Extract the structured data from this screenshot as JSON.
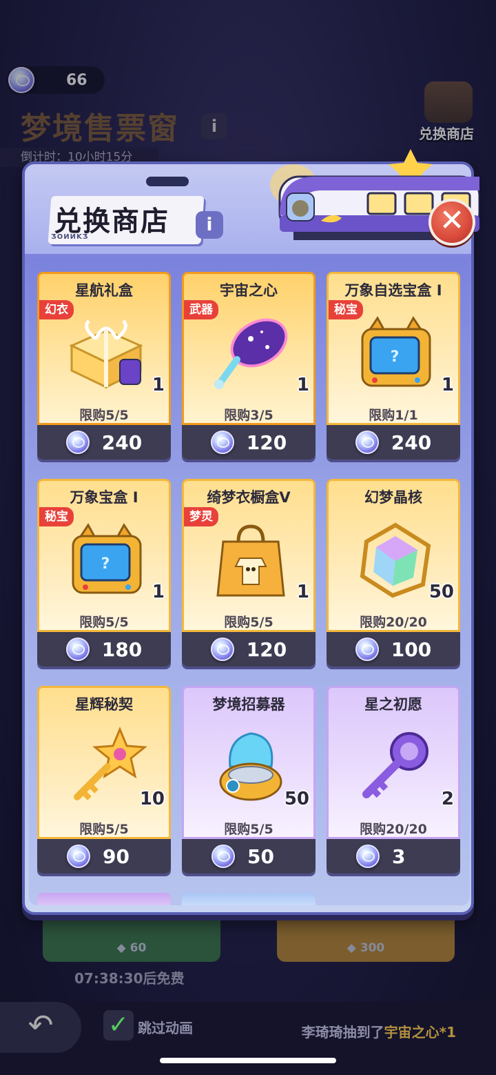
{
  "hud": {
    "currency_value": "66",
    "bg_title": "梦境售票窗",
    "countdown": "倒计时：10小时15分",
    "shop_shortcut_label": "兑换商店",
    "free_timer": "07:38:30后免费",
    "draw_once_cost": "60",
    "draw_five_cost": "300",
    "skip_animation_label": "跳过动画",
    "ticker_prefix": "李琦琦抽到了",
    "ticker_item": "宇宙之心",
    "ticker_suffix": "*1"
  },
  "modal": {
    "title": "兑换商店",
    "brand": "ƷOИИKƷ",
    "info_icon": "info-icon",
    "close_icon": "close-icon"
  },
  "items": [
    {
      "name": "星航礼盒",
      "tag": "幻衣",
      "qty": "1",
      "limit": "限购5/5",
      "price": "240",
      "style": "gold-hl",
      "icon": "gift-box-icon"
    },
    {
      "name": "宇宙之心",
      "tag": "武器",
      "qty": "1",
      "limit": "限购3/5",
      "price": "120",
      "style": "gold-hl",
      "icon": "cosmic-racket-icon"
    },
    {
      "name": "万象自选宝盒 I",
      "tag": "秘宝",
      "qty": "1",
      "limit": "限购1/1",
      "price": "240",
      "style": "gold",
      "icon": "cat-tv-box-icon"
    },
    {
      "name": "万象宝盒 I",
      "tag": "秘宝",
      "qty": "1",
      "limit": "限购5/5",
      "price": "180",
      "style": "gold",
      "icon": "cat-tv-box-icon"
    },
    {
      "name": "绮梦衣橱盒V",
      "tag": "梦灵",
      "qty": "1",
      "limit": "限购5/5",
      "price": "120",
      "style": "gold",
      "icon": "shopping-bag-icon"
    },
    {
      "name": "幻梦晶核",
      "tag": "",
      "qty": "50",
      "limit": "限购20/20",
      "price": "100",
      "style": "gold",
      "icon": "crystal-core-icon"
    },
    {
      "name": "星辉秘契",
      "tag": "",
      "qty": "10",
      "limit": "限购5/5",
      "price": "90",
      "style": "gold",
      "icon": "star-key-icon"
    },
    {
      "name": "梦境招募器",
      "tag": "",
      "qty": "50",
      "limit": "限购5/5",
      "price": "50",
      "style": "purple",
      "icon": "recruit-device-icon"
    },
    {
      "name": "星之初愿",
      "tag": "",
      "qty": "2",
      "limit": "限购20/20",
      "price": "3",
      "style": "purple",
      "icon": "purple-key-icon"
    }
  ],
  "colors": {
    "tag_red": "#e8413a",
    "card_gold": "#f4b73b",
    "card_purple": "#c5a5f4",
    "price_bar": "#3d3c52",
    "modal_blue": "#7074d8"
  }
}
